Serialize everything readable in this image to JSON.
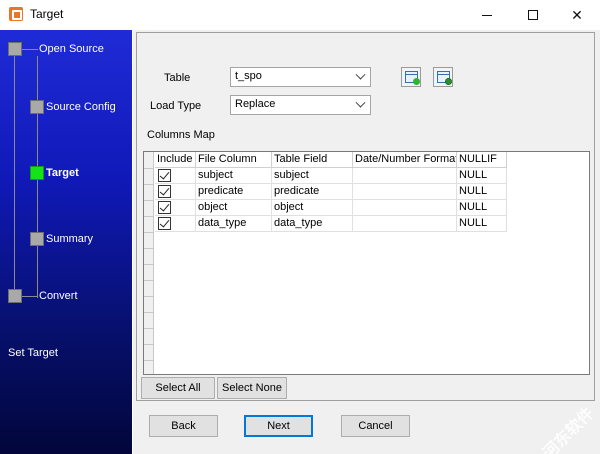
{
  "window": {
    "title": "Target",
    "minimize_icon": "minimize-icon",
    "maximize_icon": "maximize-icon",
    "close_icon": "close-icon"
  },
  "sidebar": {
    "steps": [
      {
        "label": "Open Source",
        "active": false
      },
      {
        "label": "Source Config",
        "active": false
      },
      {
        "label": "Target",
        "active": true
      },
      {
        "label": "Summary",
        "active": false
      },
      {
        "label": "Convert",
        "active": false
      }
    ],
    "status": "Set Target",
    "colors": {
      "top": "#1f2bd6",
      "bottom": "#02063a",
      "active_step": "#14e31a"
    }
  },
  "form": {
    "table_label": "Table",
    "table_value": "t_spo",
    "load_type_label": "Load Type",
    "load_type_value": "Replace",
    "columns_map_label": "Columns Map"
  },
  "grid": {
    "headers": [
      "Include",
      "File Column",
      "Table Field",
      "Date/Number Format",
      "NULLIF"
    ],
    "rows": [
      {
        "include": true,
        "file_column": "subject",
        "table_field": "subject",
        "format": "",
        "nullif": "NULL"
      },
      {
        "include": true,
        "file_column": "predicate",
        "table_field": "predicate",
        "format": "",
        "nullif": "NULL"
      },
      {
        "include": true,
        "file_column": "object",
        "table_field": "object",
        "format": "",
        "nullif": "NULL"
      },
      {
        "include": true,
        "file_column": "data_type",
        "table_field": "data_type",
        "format": "",
        "nullif": "NULL"
      }
    ]
  },
  "buttons": {
    "select_all": "Select All",
    "select_none": "Select None",
    "back": "Back",
    "next": "Next",
    "cancel": "Cancel"
  },
  "watermark": "河东软件"
}
